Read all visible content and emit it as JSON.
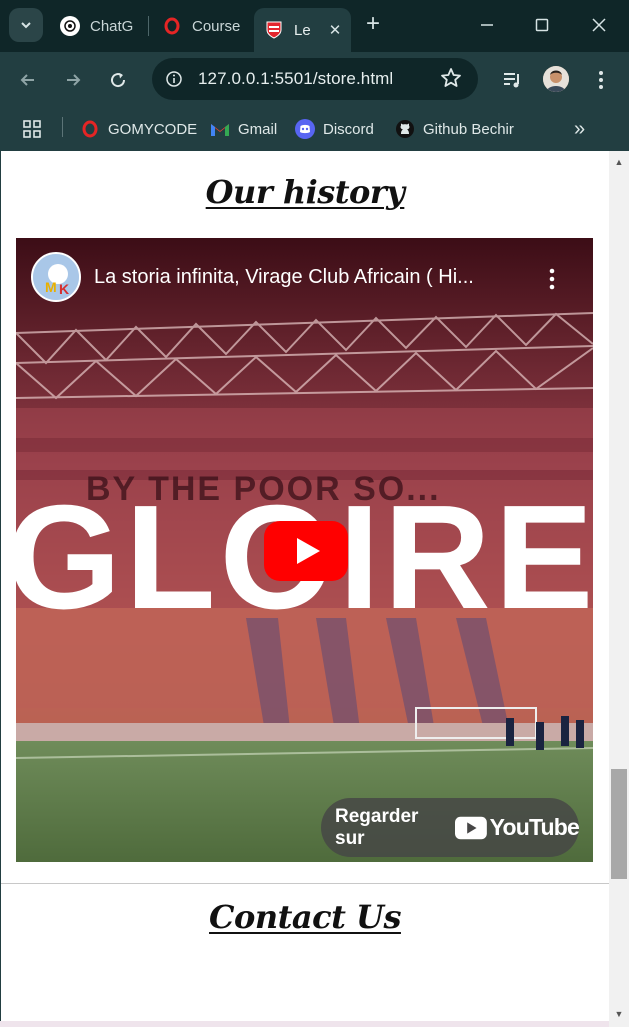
{
  "browser": {
    "tabs": [
      {
        "label": "ChatG",
        "icon": "chatgpt-icon"
      },
      {
        "label": "Course",
        "icon": "gomycode-icon"
      },
      {
        "label": "Le",
        "icon": "club-africain-icon",
        "active": true
      }
    ],
    "address": "127.0.0.1:5501/store.html",
    "bookmarks": [
      {
        "label": "GOMYCODE",
        "icon": "gomycode-icon"
      },
      {
        "label": "Gmail",
        "icon": "gmail-icon"
      },
      {
        "label": "Discord",
        "icon": "discord-icon"
      },
      {
        "label": "Github Bechir",
        "icon": "github-icon"
      }
    ]
  },
  "page": {
    "history_heading": "Our history",
    "contact_heading": "Contact Us"
  },
  "video": {
    "title": "La storia infinita, Virage Club Africain ( Hi...",
    "banner_text": "GLOIRE",
    "banner_small_text": "BY THE POOR SO...",
    "watch_label": "Regarder sur",
    "youtube_label": "YouTube"
  },
  "colors": {
    "frame": "#223e41",
    "tabstrip": "#0f2628",
    "youtube_red": "#ff0000"
  }
}
